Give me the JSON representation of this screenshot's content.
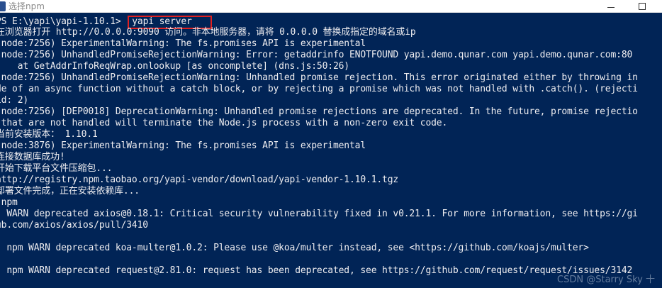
{
  "window": {
    "title": "选择npm"
  },
  "prompt": {
    "path": "PS E:\\yapi\\yapi-1.10.1> ",
    "command": "yapi server"
  },
  "output": {
    "l1": "在浏览器打开 http://0.0.0.0:9090 访问。非本地服务器，请将 0.0.0.0 替换成指定的域名或ip",
    "l2": "(node:7256) ExperimentalWarning: The fs.promises API is experimental",
    "l3": "(node:7256) UnhandledPromiseRejectionWarning: Error: getaddrinfo ENOTFOUND yapi.demo.qunar.com yapi.demo.qunar.com:80",
    "l4": "    at GetAddrInfoReqWrap.onlookup [as oncomplete] (dns.js:50:26)",
    "l5": "(node:7256) UnhandledPromiseRejectionWarning: Unhandled promise rejection. This error originated either by throwing in",
    "l6": "de of an async function without a catch block, or by rejecting a promise which was not handled with .catch(). (rejecti",
    "l7": "id: 2)",
    "l8": "(node:7256) [DEP0018] DeprecationWarning: Unhandled promise rejections are deprecated. In the future, promise rejectio",
    "l9": " that are not handled will terminate the Node.js process with a non-zero exit code.",
    "l10": "当前安装版本： 1.10.1",
    "l11": "(node:3876) ExperimentalWarning: The fs.promises API is experimental",
    "l12": "连接数据库成功!",
    "l13": "开始下载平台文件压缩包...",
    "l14": "http://registry.npm.taobao.org/yapi-vendor/download/yapi-vendor-1.10.1.tgz",
    "l15": "部署文件完成，正在安装依赖库...",
    "l16": " npm",
    "l17": "  WARN deprecated axios@0.18.1: Critical security vulnerability fixed in v0.21.1. For more information, see https://gi",
    "l18": "ub.com/axios/axios/pull/3410",
    "l19": "  npm WARN deprecated koa-multer@1.0.2: Please use @koa/multer instead, see <https://github.com/koajs/multer>",
    "l20": "  npm WARN deprecated request@2.81.0: request has been deprecated, see https://github.com/request/request/issues/3142"
  },
  "watermark": "CSDN @Starry Sky 十",
  "colors": {
    "background": "#012456",
    "text": "#eeedf0",
    "highlight_box": "#e02020"
  }
}
